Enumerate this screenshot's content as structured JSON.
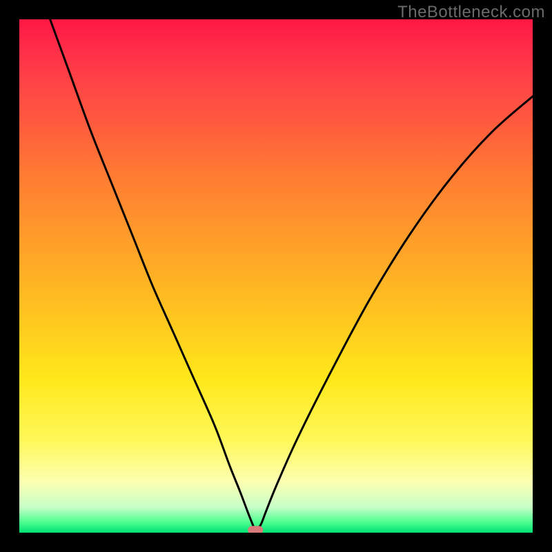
{
  "watermark": "TheBottleneck.com",
  "colors": {
    "frame": "#000000",
    "curve_stroke": "#000000",
    "marker_fill": "#d87b7b",
    "gradient_top": "#ff1744",
    "gradient_mid": "#ffe81a",
    "gradient_bottom": "#00e074"
  },
  "chart_data": {
    "type": "line",
    "title": "",
    "xlabel": "",
    "ylabel": "",
    "xlim": [
      0,
      100
    ],
    "ylim": [
      0,
      100
    ],
    "grid": false,
    "legend": false,
    "series": [
      {
        "name": "bottleneck-curve",
        "x": [
          6,
          10,
          14,
          18,
          22,
          26,
          30,
          34,
          38,
          41,
          43,
          44.5,
          45.5,
          46,
          47,
          48,
          50,
          54,
          60,
          68,
          76,
          84,
          92,
          100
        ],
        "y": [
          100,
          89,
          78,
          68,
          58,
          48,
          39,
          30,
          21,
          13,
          8,
          4,
          1.5,
          0.5,
          1.5,
          4,
          9,
          18,
          30,
          45,
          58,
          69,
          78,
          85
        ]
      }
    ],
    "marker": {
      "x": 46,
      "y": 0.5,
      "shape": "rounded-rect"
    },
    "background_gradient": {
      "direction": "vertical",
      "stops": [
        {
          "pos": 0.0,
          "color": "#ff1744"
        },
        {
          "pos": 0.3,
          "color": "#ff7a33"
        },
        {
          "pos": 0.58,
          "color": "#ffc61f"
        },
        {
          "pos": 0.82,
          "color": "#fff85a"
        },
        {
          "pos": 0.95,
          "color": "#c8ffc8"
        },
        {
          "pos": 1.0,
          "color": "#00e074"
        }
      ]
    }
  }
}
